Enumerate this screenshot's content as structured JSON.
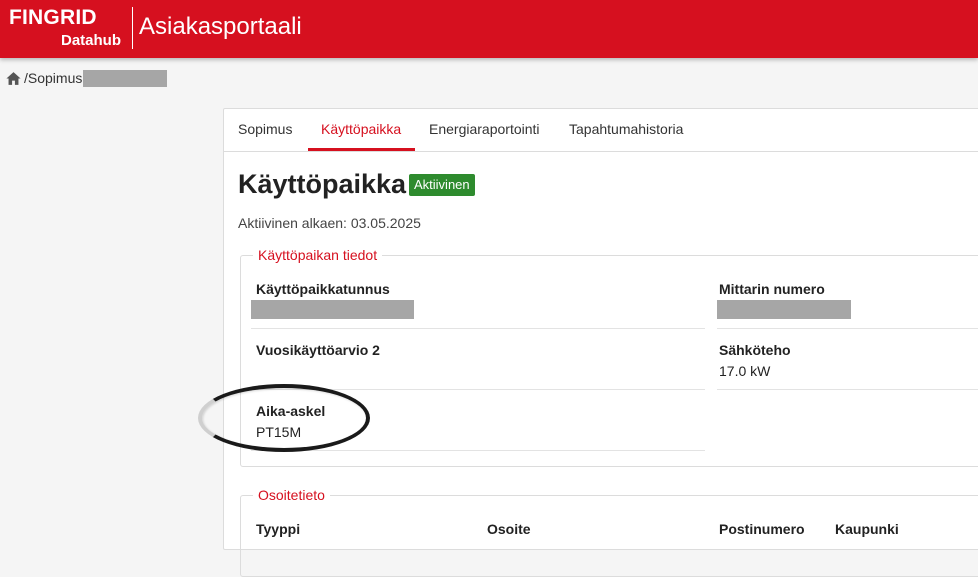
{
  "header": {
    "logo_main": "FINGRID",
    "logo_sub": "Datahub",
    "app_title": "Asiakasportaali",
    "brand_color": "#d6101f"
  },
  "breadcrumb": {
    "home_icon": "home-icon",
    "separator": "/",
    "item": "Sopimus"
  },
  "tabs": [
    {
      "label": "Sopimus",
      "active": false
    },
    {
      "label": "Käyttöpaikka",
      "active": true
    },
    {
      "label": "Energiaraportointi",
      "active": false
    },
    {
      "label": "Tapahtumahistoria",
      "active": false
    }
  ],
  "page": {
    "title": "Käyttöpaikka",
    "status_badge": "Aktiivinen",
    "status_color": "#2e8b2e",
    "active_since": "Aktiivinen alkaen: 03.05.2025"
  },
  "section_details": {
    "legend": "Käyttöpaikan tiedot",
    "fields": {
      "metering_point_id": {
        "label": "Käyttöpaikkatunnus",
        "value": ""
      },
      "meter_number": {
        "label": "Mittarin numero",
        "value": ""
      },
      "annual_estimate": {
        "label": "Vuosikäyttöarvio 2",
        "value": ""
      },
      "power": {
        "label": "Sähköteho",
        "value": "17.0 kW"
      },
      "time_step": {
        "label": "Aika-askel",
        "value": "PT15M"
      }
    }
  },
  "section_address": {
    "legend": "Osoitetieto",
    "columns": [
      "Tyyppi",
      "Osoite",
      "Postinumero",
      "Kaupunki"
    ]
  }
}
